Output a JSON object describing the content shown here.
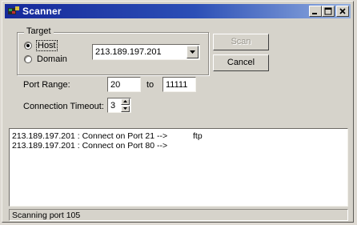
{
  "window": {
    "title": "Scanner"
  },
  "target": {
    "legend": "Target",
    "host_label": "Host",
    "domain_label": "Domain",
    "selected": "Host",
    "address": "213.189.197.201"
  },
  "buttons": {
    "scan": "Scan",
    "cancel": "Cancel"
  },
  "port_range": {
    "label": "Port Range:",
    "from": "20",
    "to_label": "to",
    "to": "11111"
  },
  "timeout": {
    "label": "Connection Timeout:",
    "value": "3"
  },
  "log": {
    "rows": [
      {
        "text": "213.189.197.201 : Connect on Port 21  -->",
        "service": "ftp"
      },
      {
        "text": "213.189.197.201 : Connect on Port 80  -->",
        "service": ""
      }
    ]
  },
  "status": {
    "text": "Scanning port 105"
  },
  "colors": {
    "title_start": "#16299a",
    "title_end": "#92aee0",
    "face": "#d6d3cb"
  }
}
